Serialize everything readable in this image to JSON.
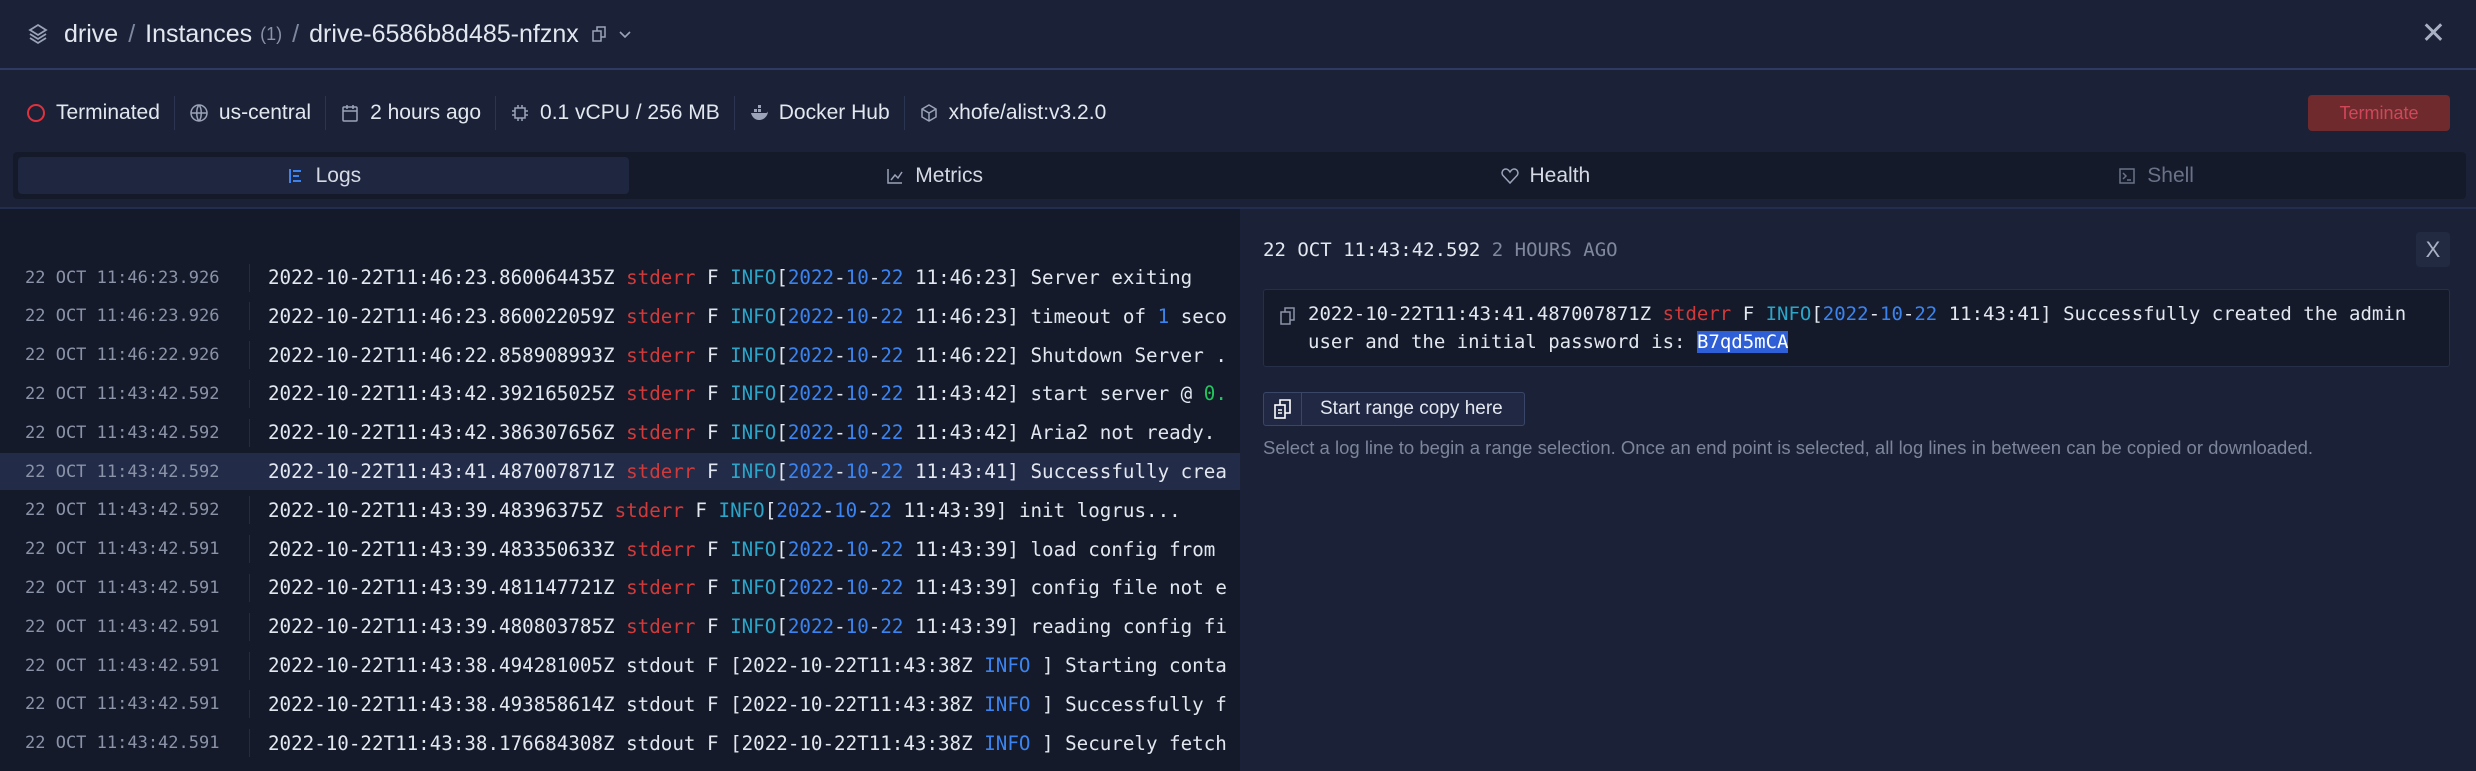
{
  "header": {
    "project": "drive",
    "section": "Instances",
    "count": "(1)",
    "instance": "drive-6586b8d485-nfznx",
    "separator": "/",
    "close": "✕"
  },
  "info": {
    "status": "Terminated",
    "region": "us-central",
    "created": "2 hours ago",
    "resources": "0.1 vCPU / 256 MB",
    "registry": "Docker Hub",
    "image": "xhofe/alist:v3.2.0",
    "terminate_label": "Terminate"
  },
  "tabs": [
    {
      "label": "Logs"
    },
    {
      "label": "Metrics"
    },
    {
      "label": "Health"
    },
    {
      "label": "Shell"
    }
  ],
  "colors": {
    "accent": "#3b84f0",
    "error": "#d13a3a",
    "info": "#2ba5c8",
    "terminate_bg": "#6e2a2c"
  },
  "logs": [
    {
      "ts": "22 OCT 11:46:23.926",
      "seg": [
        [
          "2022-10-22T11:46:23.860064435Z ",
          ""
        ],
        [
          "stderr",
          "err"
        ],
        [
          " F ",
          ""
        ],
        [
          "INFO",
          "info"
        ],
        [
          "[",
          ""
        ],
        [
          "2022",
          "date"
        ],
        [
          "-",
          ""
        ],
        [
          "10",
          "date"
        ],
        [
          "-",
          ""
        ],
        [
          "22",
          "date"
        ],
        [
          " 11:46:23] Server exiting",
          ""
        ]
      ]
    },
    {
      "ts": "22 OCT 11:46:23.926",
      "seg": [
        [
          "2022-10-22T11:46:23.860022059Z ",
          ""
        ],
        [
          "stderr",
          "err"
        ],
        [
          " F ",
          ""
        ],
        [
          "INFO",
          "info"
        ],
        [
          "[",
          ""
        ],
        [
          "2022",
          "date"
        ],
        [
          "-",
          ""
        ],
        [
          "10",
          "date"
        ],
        [
          "-",
          ""
        ],
        [
          "22",
          "date"
        ],
        [
          " 11:46:23] timeout of ",
          ""
        ],
        [
          "1",
          "num"
        ],
        [
          " seco",
          ""
        ]
      ]
    },
    {
      "ts": "22 OCT 11:46:22.926",
      "seg": [
        [
          "2022-10-22T11:46:22.858908993Z ",
          ""
        ],
        [
          "stderr",
          "err"
        ],
        [
          " F ",
          ""
        ],
        [
          "INFO",
          "info"
        ],
        [
          "[",
          ""
        ],
        [
          "2022",
          "date"
        ],
        [
          "-",
          ""
        ],
        [
          "10",
          "date"
        ],
        [
          "-",
          ""
        ],
        [
          "22",
          "date"
        ],
        [
          " 11:46:22] Shutdown Server .",
          ""
        ]
      ]
    },
    {
      "ts": "22 OCT 11:43:42.592",
      "seg": [
        [
          "2022-10-22T11:43:42.392165025Z ",
          ""
        ],
        [
          "stderr",
          "err"
        ],
        [
          " F ",
          ""
        ],
        [
          "INFO",
          "info"
        ],
        [
          "[",
          ""
        ],
        [
          "2022",
          "date"
        ],
        [
          "-",
          ""
        ],
        [
          "10",
          "date"
        ],
        [
          "-",
          ""
        ],
        [
          "22",
          "date"
        ],
        [
          " 11:43:42] start server @ ",
          ""
        ],
        [
          "0.",
          "green"
        ]
      ]
    },
    {
      "ts": "22 OCT 11:43:42.592",
      "seg": [
        [
          "2022-10-22T11:43:42.386307656Z ",
          ""
        ],
        [
          "stderr",
          "err"
        ],
        [
          " F ",
          ""
        ],
        [
          "INFO",
          "info"
        ],
        [
          "[",
          ""
        ],
        [
          "2022",
          "date"
        ],
        [
          "-",
          ""
        ],
        [
          "10",
          "date"
        ],
        [
          "-",
          ""
        ],
        [
          "22",
          "date"
        ],
        [
          " 11:43:42] Aria2 not ready.",
          ""
        ]
      ]
    },
    {
      "ts": "22 OCT 11:43:42.592",
      "selected": true,
      "seg": [
        [
          "2022-10-22T11:43:41.487007871Z ",
          ""
        ],
        [
          "stderr",
          "err"
        ],
        [
          " F ",
          ""
        ],
        [
          "INFO",
          "info"
        ],
        [
          "[",
          ""
        ],
        [
          "2022",
          "date"
        ],
        [
          "-",
          ""
        ],
        [
          "10",
          "date"
        ],
        [
          "-",
          ""
        ],
        [
          "22",
          "date"
        ],
        [
          " 11:43:41] Successfully crea",
          ""
        ]
      ]
    },
    {
      "ts": "22 OCT 11:43:42.592",
      "seg": [
        [
          "2022-10-22T11:43:39.48396375Z ",
          ""
        ],
        [
          "stderr",
          "err"
        ],
        [
          " F ",
          ""
        ],
        [
          "INFO",
          "info"
        ],
        [
          "[",
          ""
        ],
        [
          "2022",
          "date"
        ],
        [
          "-",
          ""
        ],
        [
          "10",
          "date"
        ],
        [
          "-",
          ""
        ],
        [
          "22",
          "date"
        ],
        [
          " 11:43:39] init logrus...",
          ""
        ]
      ]
    },
    {
      "ts": "22 OCT 11:43:42.591",
      "seg": [
        [
          "2022-10-22T11:43:39.483350633Z ",
          ""
        ],
        [
          "stderr",
          "err"
        ],
        [
          " F ",
          ""
        ],
        [
          "INFO",
          "info"
        ],
        [
          "[",
          ""
        ],
        [
          "2022",
          "date"
        ],
        [
          "-",
          ""
        ],
        [
          "10",
          "date"
        ],
        [
          "-",
          ""
        ],
        [
          "22",
          "date"
        ],
        [
          " 11:43:39] load config from",
          ""
        ]
      ]
    },
    {
      "ts": "22 OCT 11:43:42.591",
      "seg": [
        [
          "2022-10-22T11:43:39.481147721Z ",
          ""
        ],
        [
          "stderr",
          "err"
        ],
        [
          " F ",
          ""
        ],
        [
          "INFO",
          "info"
        ],
        [
          "[",
          ""
        ],
        [
          "2022",
          "date"
        ],
        [
          "-",
          ""
        ],
        [
          "10",
          "date"
        ],
        [
          "-",
          ""
        ],
        [
          "22",
          "date"
        ],
        [
          " 11:43:39] config file not e",
          ""
        ]
      ]
    },
    {
      "ts": "22 OCT 11:43:42.591",
      "seg": [
        [
          "2022-10-22T11:43:39.480803785Z ",
          ""
        ],
        [
          "stderr",
          "err"
        ],
        [
          " F ",
          ""
        ],
        [
          "INFO",
          "info"
        ],
        [
          "[",
          ""
        ],
        [
          "2022",
          "date"
        ],
        [
          "-",
          ""
        ],
        [
          "10",
          "date"
        ],
        [
          "-",
          ""
        ],
        [
          "22",
          "date"
        ],
        [
          " 11:43:39] reading config fi",
          ""
        ]
      ]
    },
    {
      "ts": "22 OCT 11:43:42.591",
      "seg": [
        [
          "2022-10-22T11:43:38.494281005Z stdout F [2022-10-22T11:43:38Z ",
          ""
        ],
        [
          "INFO",
          "date"
        ],
        [
          " ] Starting conta",
          ""
        ]
      ]
    },
    {
      "ts": "22 OCT 11:43:42.591",
      "seg": [
        [
          "2022-10-22T11:43:38.493858614Z stdout F [2022-10-22T11:43:38Z ",
          ""
        ],
        [
          "INFO",
          "date"
        ],
        [
          " ] Successfully f",
          ""
        ]
      ]
    },
    {
      "ts": "22 OCT 11:43:42.591",
      "seg": [
        [
          "2022-10-22T11:43:38.176684308Z stdout F [2022-10-22T11:43:38Z ",
          ""
        ],
        [
          "INFO",
          "date"
        ],
        [
          " ] Securely fetch",
          ""
        ]
      ]
    }
  ],
  "detail": {
    "timestamp": "22 OCT 11:43:42.592",
    "ago": "2 HOURS AGO",
    "close": "X",
    "seg": [
      [
        "2022-10-22T11:43:41.487007871Z ",
        ""
      ],
      [
        "stderr",
        "err"
      ],
      [
        " F ",
        ""
      ],
      [
        "INFO",
        "info"
      ],
      [
        "[",
        ""
      ],
      [
        "2022",
        "date"
      ],
      [
        "-",
        ""
      ],
      [
        "10",
        "date"
      ],
      [
        "-",
        ""
      ],
      [
        "22",
        "date"
      ],
      [
        " 11:43:41] Successfully created the admin user and the initial password is: ",
        ""
      ],
      [
        "B7qd5mCA",
        "hl"
      ]
    ],
    "range_button": "Start range copy here",
    "help": "Select a log line to begin a range selection. Once an end point is selected, all log lines in between can be copied or downloaded."
  }
}
